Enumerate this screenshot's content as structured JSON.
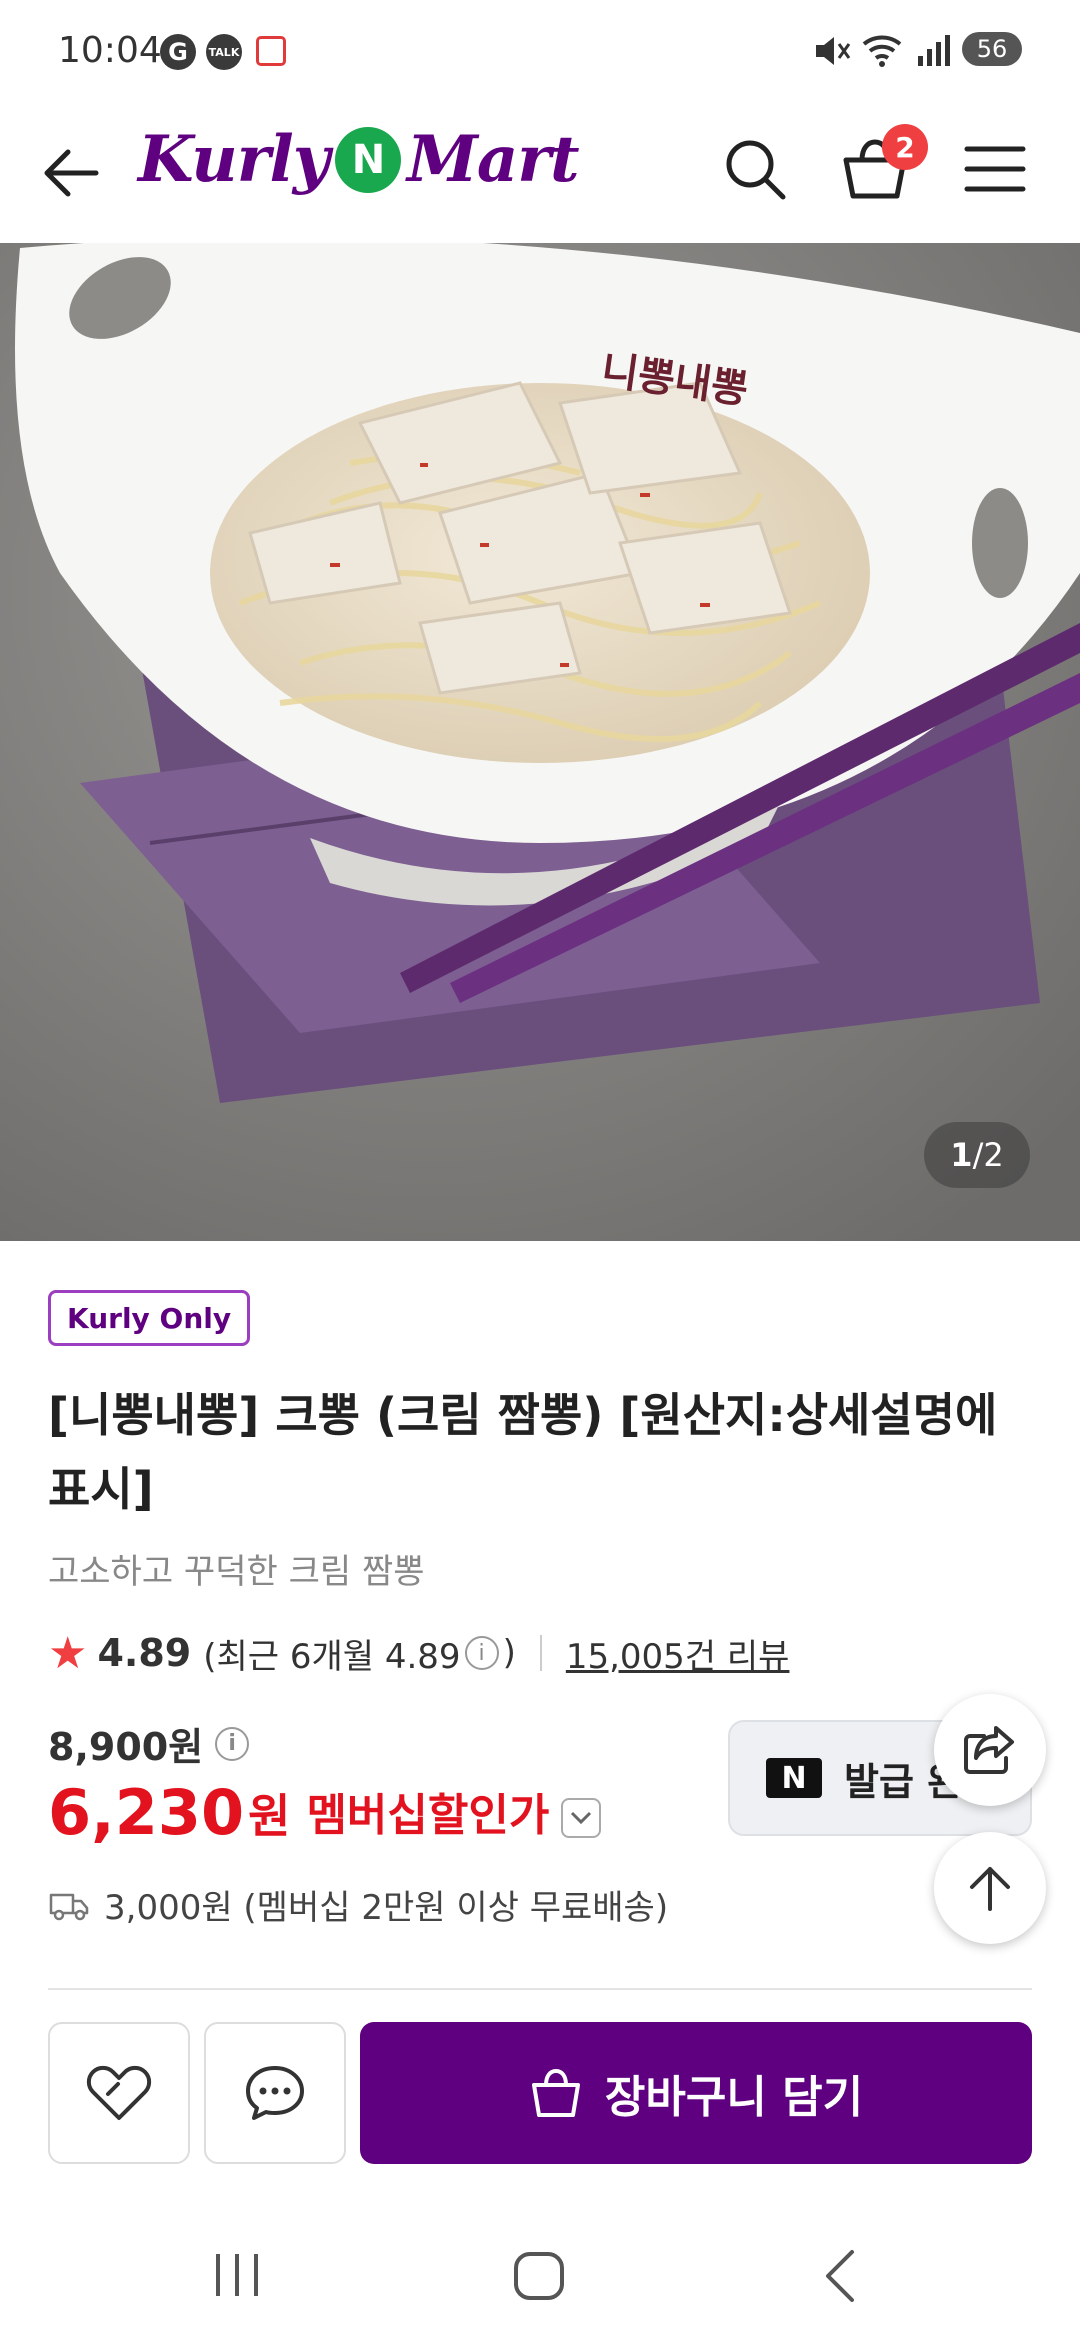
{
  "status_bar": {
    "time": "10:04",
    "icons": [
      "google-icon",
      "kakaotalk-icon",
      "calendar-icon",
      "mute-icon",
      "wifi-icon",
      "signal-icon"
    ],
    "talk_label": "TALK",
    "battery": "56"
  },
  "header": {
    "logo_left": "Kurly",
    "logo_n": "N",
    "logo_right": "Mart",
    "cart_count": "2",
    "brand_color": "#5f0080"
  },
  "gallery": {
    "current": "1",
    "separator": "/",
    "total": "2",
    "bowl_text": "니뽕내뽕"
  },
  "product": {
    "badge": "Kurly Only",
    "title": "[니뽕내뽕] 크뽕 (크림 짬뽕) [원산지:상세설명에 표시]",
    "subtitle": "고소하고 꾸덕한 크림 짬뽕",
    "rating": "4.89",
    "rating_recent_prefix": "(최근 6개월 4.89",
    "rating_recent_suffix": ")",
    "review_count": "15,005건 리뷰",
    "original_price": "8,900원",
    "sale_price": "6,230",
    "sale_unit": "원",
    "membership_label": "멤버십할인가",
    "coupon_label": "발급 완",
    "delivery": "3,000원 (멤버십 2만원 이상 무료배송)",
    "sale_color": "#e2131e"
  },
  "bottom_bar": {
    "cart_button": "장바구니 담기"
  }
}
